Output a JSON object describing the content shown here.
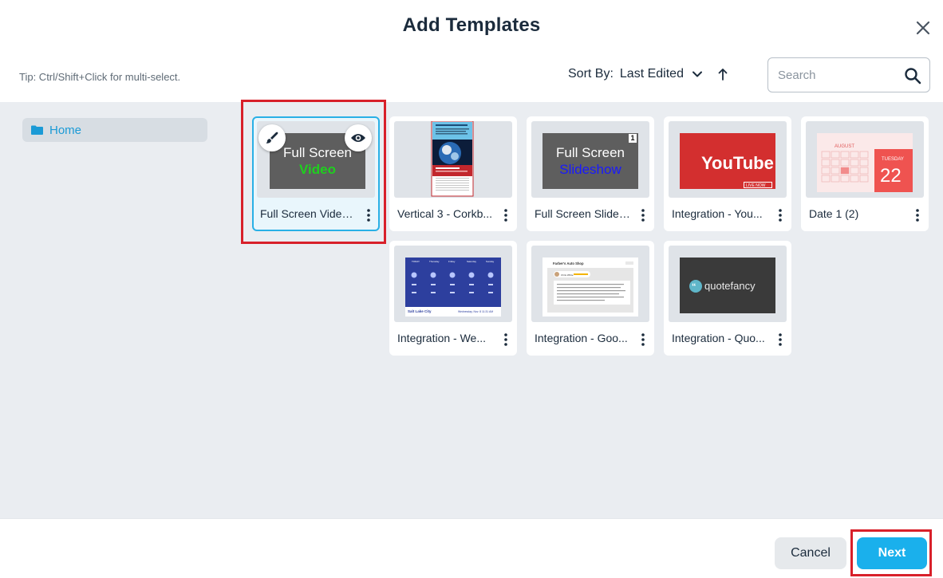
{
  "dialog": {
    "title": "Add Templates",
    "tip": "Tip: Ctrl/Shift+Click for multi-select."
  },
  "sort": {
    "label": "Sort By:",
    "value": "Last Edited"
  },
  "search": {
    "placeholder": "Search"
  },
  "folders": [
    {
      "label": "Home"
    }
  ],
  "templates": [
    {
      "name": "Full Screen Video ...",
      "thumb_line1": "Full Screen",
      "thumb_line2": "Video",
      "selected": true
    },
    {
      "name": "Vertical 3 - Corkb..."
    },
    {
      "name": "Full Screen Slides...",
      "thumb_line1": "Full Screen",
      "thumb_line2": "Slideshow",
      "badge": "1"
    },
    {
      "name": "Integration - You...",
      "thumb_text": "YouTube",
      "thumb_badge": "LIVE NOW"
    },
    {
      "name": "Date 1 (2)",
      "thumb_month": "AUGUST",
      "thumb_weekday": "TUESDAY",
      "thumb_day": "22"
    },
    {
      "name": "Integration - We...",
      "thumb_city": "Salt Lake City",
      "thumb_date": "Wednesday, Nov. 8  11:31 AM",
      "thumb_days": [
        "TODAY",
        "Thursday",
        "Friday",
        "Saturday",
        "Sunday"
      ]
    },
    {
      "name": "Integration - Goo...",
      "thumb_title": "Farber's Auto Shop",
      "thumb_reviewer": "Chris White"
    },
    {
      "name": "Integration - Quo...",
      "thumb_text": "quotefancy"
    }
  ],
  "footer": {
    "cancel_label": "Cancel",
    "next_label": "Next"
  },
  "colors": {
    "accent": "#1ab0ec",
    "highlight": "#d8202a",
    "folder_text": "#1a9ad6"
  }
}
